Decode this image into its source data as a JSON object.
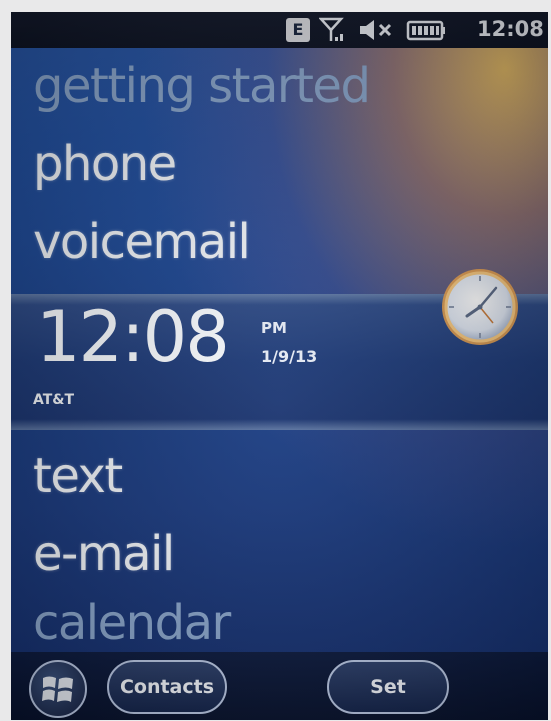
{
  "status_bar": {
    "network_badge": "E",
    "signal_icon": "signal-icon",
    "volume_icon": "volume-muted-icon",
    "battery_icon": "battery-icon",
    "time": "12:08"
  },
  "menu": {
    "items": [
      {
        "label": "getting started"
      },
      {
        "label": "phone"
      },
      {
        "label": "voicemail"
      },
      {
        "label": "text"
      },
      {
        "label": "e-mail"
      },
      {
        "label": "calendar"
      }
    ]
  },
  "clock": {
    "time": "12:08",
    "ampm": "PM",
    "date": "1/9/13",
    "carrier": "AT&T"
  },
  "softkeys": {
    "start_icon": "windows-start-icon",
    "left": "Contacts",
    "right": "Set"
  },
  "colors": {
    "background_blue": "#1e4a98",
    "status_bar": "#141a2c",
    "text": "#f4f7fb",
    "dim_text": "#8aa6cc"
  }
}
